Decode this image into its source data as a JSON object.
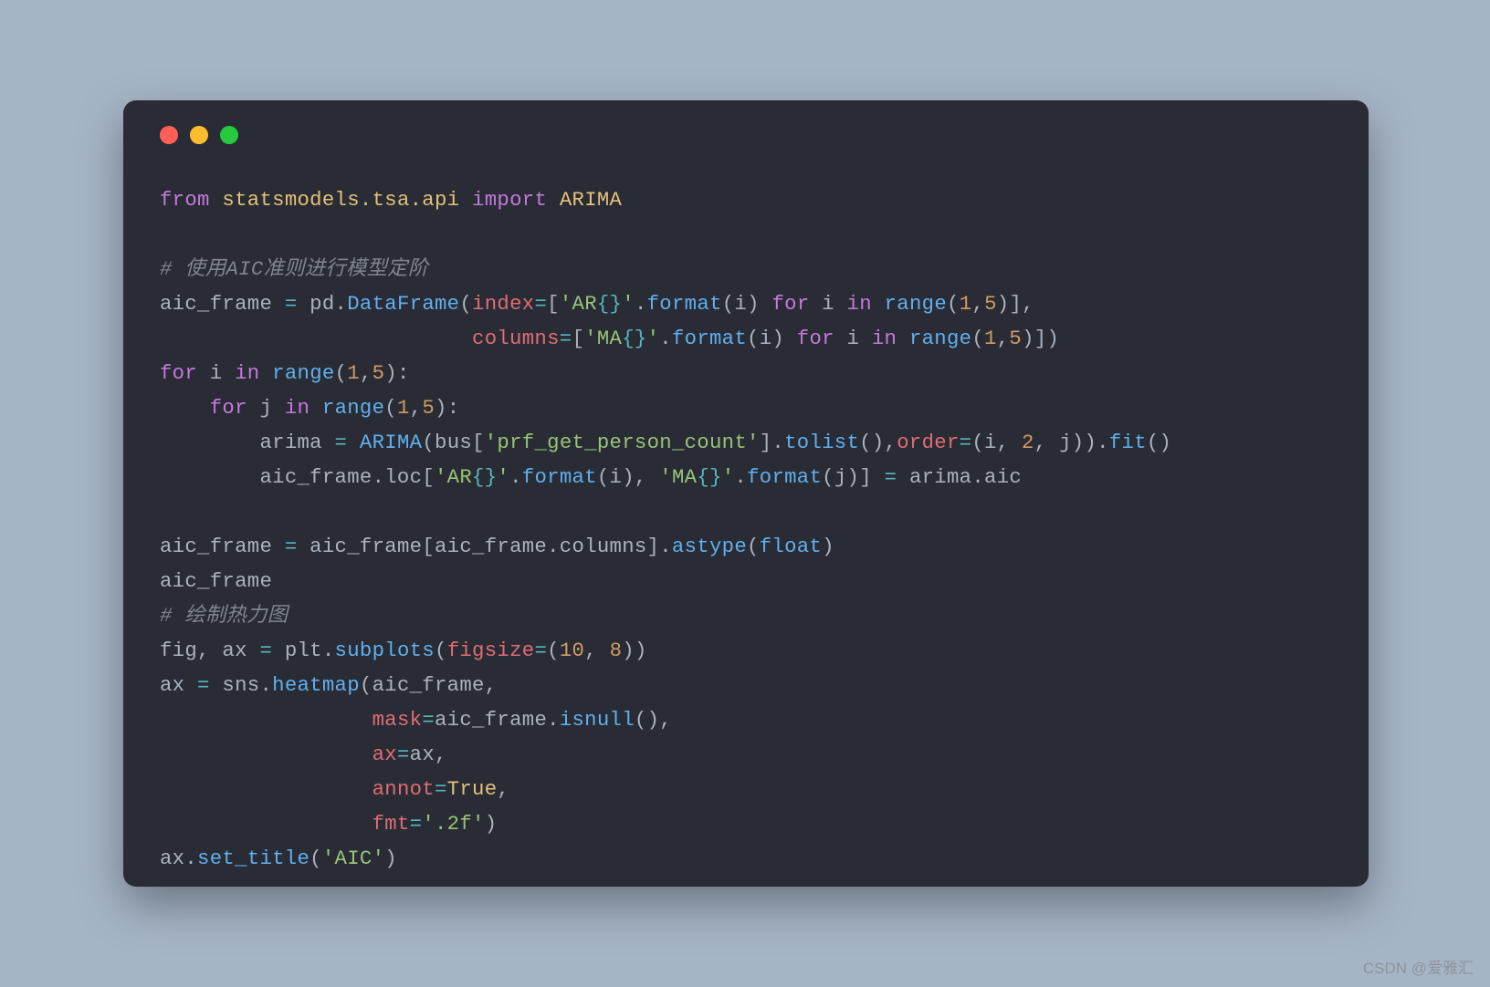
{
  "window": {
    "dots": {
      "close": "#FF5F56",
      "minimize": "#FFBD2E",
      "zoom": "#27C93F"
    }
  },
  "code": {
    "L1": {
      "t1": "from",
      "t2": "statsmodels.tsa.api",
      "t3": "import",
      "t4": "ARIMA"
    },
    "L3": {
      "t1": "# 使用AIC准则进行模型定阶"
    },
    "L4": {
      "t1": "aic_frame ",
      "t2": "=",
      "t3": " pd.",
      "t4": "DataFrame",
      "t5": "(",
      "t6": "index",
      "t7": "=",
      "t8": "[",
      "t9": "'AR",
      "t10": "{}",
      "t11": "'",
      "t12": ".",
      "t13": "format",
      "t14": "(i) ",
      "t15": "for",
      "t16": " i ",
      "t17": "in",
      "t18": " ",
      "t19": "range",
      "t20": "(",
      "t21": "1",
      "t22": ",",
      "t23": "5",
      "t24": ")],"
    },
    "L5": {
      "pad": "                         ",
      "t6": "columns",
      "t7": "=",
      "t8": "[",
      "t9": "'MA",
      "t10": "{}",
      "t11": "'",
      "t12": ".",
      "t13": "format",
      "t14": "(i) ",
      "t15": "for",
      "t16": " i ",
      "t17": "in",
      "t18": " ",
      "t19": "range",
      "t20": "(",
      "t21": "1",
      "t22": ",",
      "t23": "5",
      "t24": ")])"
    },
    "L6": {
      "t1": "for",
      "t2": " i ",
      "t3": "in",
      "t4": " ",
      "t5": "range",
      "t6": "(",
      "t7": "1",
      "t8": ",",
      "t9": "5",
      "t10": "):"
    },
    "L7": {
      "pad": "    ",
      "t1": "for",
      "t2": " j ",
      "t3": "in",
      "t4": " ",
      "t5": "range",
      "t6": "(",
      "t7": "1",
      "t8": ",",
      "t9": "5",
      "t10": "):"
    },
    "L8": {
      "pad": "        ",
      "t1": "arima ",
      "t2": "=",
      "t3": " ",
      "t4": "ARIMA",
      "t5": "(bus[",
      "t6": "'prf_get_person_count'",
      "t7": "].",
      "t8": "tolist",
      "t9": "(),",
      "t10": "order",
      "t11": "=",
      "t12": "(i, ",
      "t13": "2",
      "t14": ", j)).",
      "t15": "fit",
      "t16": "()"
    },
    "L9": {
      "pad": "        ",
      "t1": "aic_frame.loc[",
      "t2": "'AR",
      "t3": "{}",
      "t4": "'",
      "t5": ".",
      "t6": "format",
      "t7": "(i), ",
      "t8": "'MA",
      "t9": "{}",
      "t10": "'",
      "t11": ".",
      "t12": "format",
      "t13": "(j)] ",
      "t14": "=",
      "t15": " arima.aic"
    },
    "L11": {
      "t1": "aic_frame ",
      "t2": "=",
      "t3": " aic_frame[aic_frame.columns].",
      "t4": "astype",
      "t5": "(",
      "t6": "float",
      "t7": ")"
    },
    "L12": {
      "t1": "aic_frame"
    },
    "L13": {
      "t1": "# 绘制热力图"
    },
    "L14": {
      "t1": "fig, ax ",
      "t2": "=",
      "t3": " plt.",
      "t4": "subplots",
      "t5": "(",
      "t6": "figsize",
      "t7": "=",
      "t8": "(",
      "t9": "10",
      "t10": ", ",
      "t11": "8",
      "t12": "))"
    },
    "L15": {
      "t1": "ax ",
      "t2": "=",
      "t3": " sns.",
      "t4": "heatmap",
      "t5": "(aic_frame,"
    },
    "L16": {
      "pad": "                 ",
      "t1": "mask",
      "t2": "=",
      "t3": "aic_frame.",
      "t4": "isnull",
      "t5": "(),"
    },
    "L17": {
      "pad": "                 ",
      "t1": "ax",
      "t2": "=",
      "t3": "ax,"
    },
    "L18": {
      "pad": "                 ",
      "t1": "annot",
      "t2": "=",
      "t3": "True",
      "t4": ","
    },
    "L19": {
      "pad": "                 ",
      "t1": "fmt",
      "t2": "=",
      "t3": "'.2f'",
      "t4": ")"
    },
    "L20": {
      "t1": "ax.",
      "t2": "set_title",
      "t3": "(",
      "t4": "'AIC'",
      "t5": ")"
    }
  },
  "watermark": "CSDN @爱雅汇"
}
